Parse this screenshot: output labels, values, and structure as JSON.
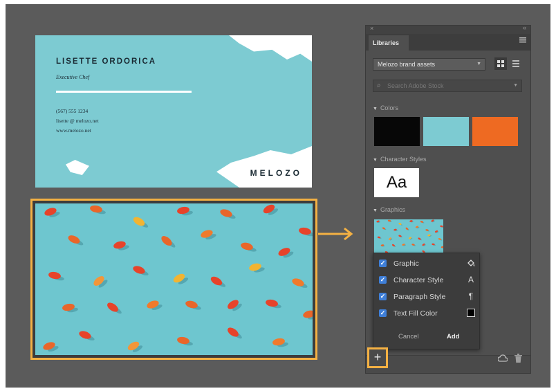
{
  "card": {
    "name": "LISETTE ORDORICA",
    "role": "Executive Chef",
    "phone": "(567) 555 1234",
    "email": "lisette @ melozo.net",
    "website": "www.melozo.net",
    "brand": "MELOZO"
  },
  "panel": {
    "close_glyph": "×",
    "collapse_glyph": "«",
    "tab_label": "Libraries",
    "library_select_value": "Melozo brand assets",
    "search_placeholder": "Search Adobe Stock",
    "sections": {
      "colors": "Colors",
      "character_styles": "Character Styles",
      "graphics": "Graphics"
    },
    "character_sample": "Aa",
    "colors": [
      "#070707",
      "#7dcbd2",
      "#ee6a22"
    ]
  },
  "add_menu": {
    "options": [
      {
        "label": "Graphic",
        "checked": true,
        "icon": "paint-bucket-icon"
      },
      {
        "label": "Character Style",
        "checked": true,
        "icon": "character-style-icon"
      },
      {
        "label": "Paragraph Style",
        "checked": true,
        "icon": "paragraph-style-icon"
      },
      {
        "label": "Text Fill Color",
        "checked": true,
        "icon": "fill-color-swatch-icon"
      }
    ],
    "cancel_label": "Cancel",
    "add_label": "Add"
  },
  "bottom_bar": {
    "add_glyph": "+"
  },
  "colors": {
    "highlight": "#f4b143",
    "background": "#5b5b5b",
    "panel": "#4f4f4f",
    "checkbox": "#3f7fd8"
  }
}
